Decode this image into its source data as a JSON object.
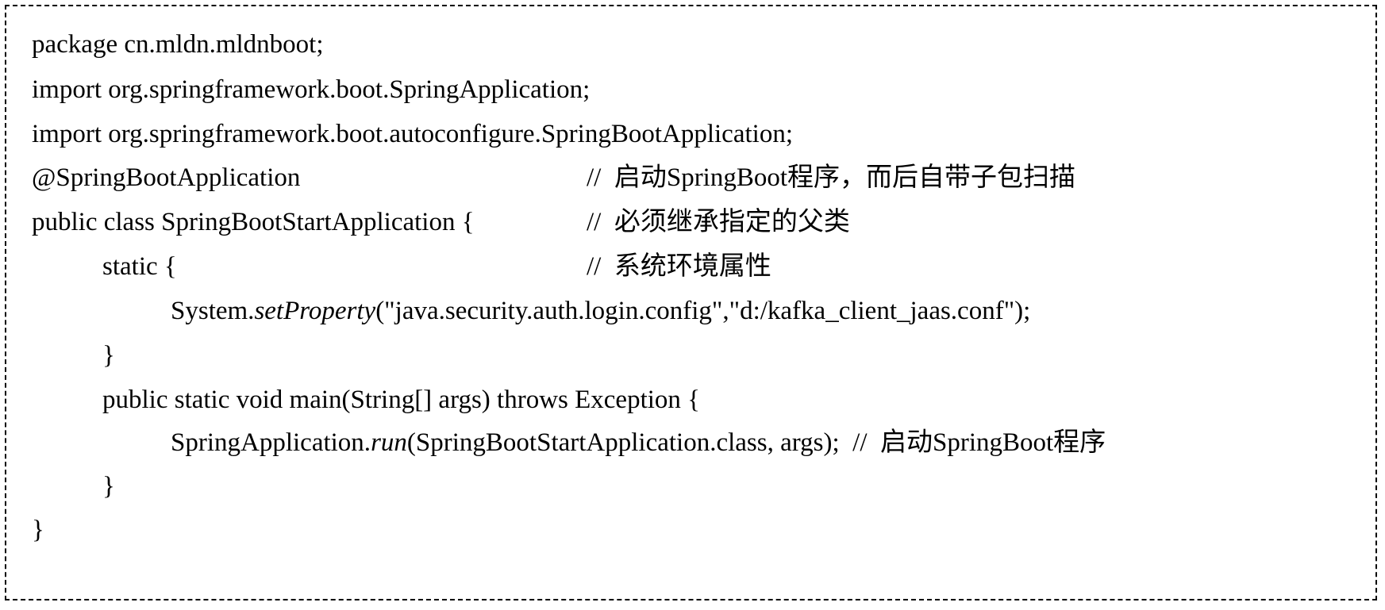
{
  "code": {
    "line1": "package cn.mldn.mldnboot;",
    "line2": "import org.springframework.boot.SpringApplication;",
    "line3": "import org.springframework.boot.autoconfigure.SpringBootApplication;",
    "line4": "@SpringBootApplication",
    "line4_comment": "//  启动SpringBoot程序，而后自带子包扫描",
    "line5": "public class SpringBootStartApplication {",
    "line5_comment": "//  必须继承指定的父类",
    "line6": "static {",
    "line6_comment": "//  系统环境属性",
    "line7_pre": "System.",
    "line7_method": "setProperty",
    "line7_post": "(\"java.security.auth.login.config\",\"d:/kafka_client_jaas.conf\");",
    "line8": "}",
    "line9": "public static void main(String[] args) throws Exception {",
    "line10_pre": "SpringApplication.",
    "line10_method": "run",
    "line10_post": "(SpringBootStartApplication.class, args);  //  启动SpringBoot程序",
    "line11": "}",
    "line12": "}"
  }
}
